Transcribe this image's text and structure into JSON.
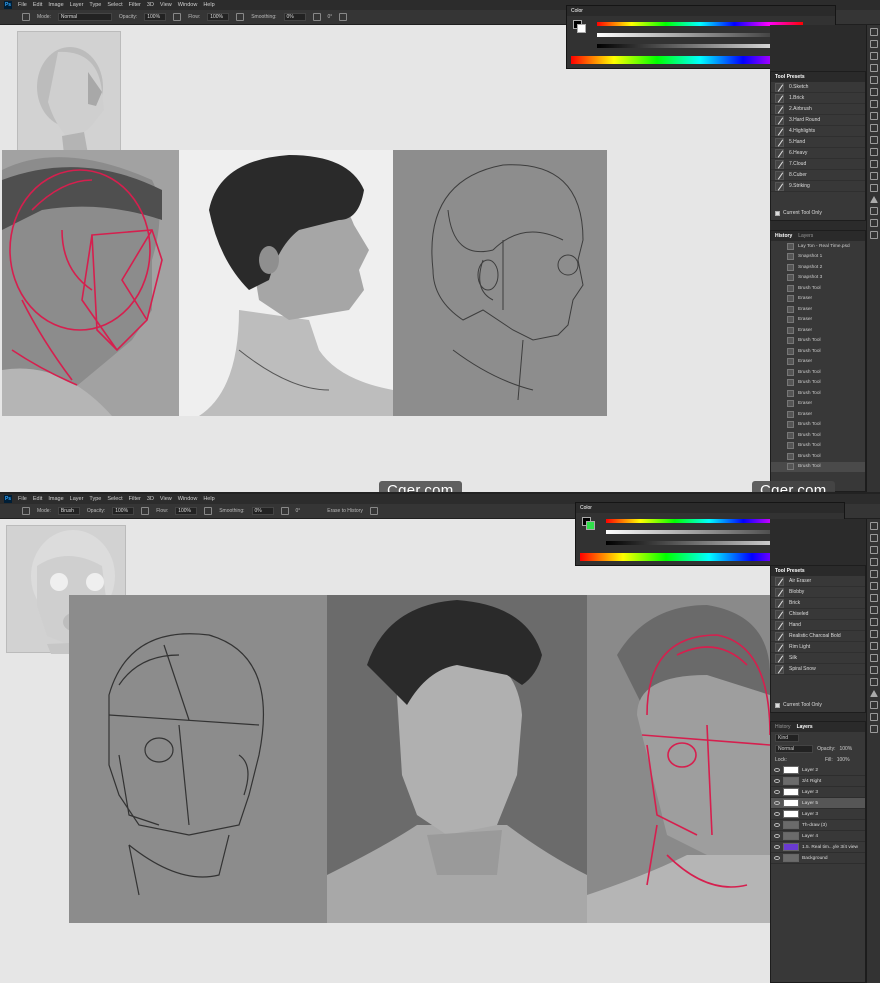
{
  "app": {
    "menu": [
      "File",
      "Edit",
      "Image",
      "Layer",
      "Type",
      "Select",
      "Filter",
      "3D",
      "View",
      "Window",
      "Help"
    ]
  },
  "top": {
    "options": {
      "mode_label": "Mode:",
      "mode_value": "Normal",
      "opacity_label": "Opacity:",
      "opacity_value": "100%",
      "flow_label": "Flow:",
      "flow_value": "100%",
      "smoothing_label": "Smoothing:",
      "smoothing_value": "0%",
      "angle_value": "0°"
    },
    "color_panel": {
      "title": "Color"
    },
    "tool_presets": {
      "title": "Tool Presets",
      "items": [
        "0.Sketch",
        "1.Brick",
        "2.Airbrush",
        "3.Hard Round",
        "4.Highlights",
        "5.Hand",
        "6.Heavy",
        "7.Cloud",
        "8.Cuber",
        "9.Striking"
      ],
      "current_only": "Current Tool Only"
    },
    "history": {
      "tab_active": "History",
      "tab_other": "Layers",
      "doc": "Lay Ton - Real Time.psd",
      "snapshots": [
        "Snapshot 1",
        "Snapshot 2",
        "Snapshot 3"
      ],
      "steps": [
        "Brush Tool",
        "Eraser",
        "Eraser",
        "Eraser",
        "Eraser",
        "Brush Tool",
        "Brush Tool",
        "Eraser",
        "Brush Tool",
        "Brush Tool",
        "Brush Tool",
        "Eraser",
        "Eraser",
        "Brush Tool",
        "Brush Tool",
        "Brush Tool",
        "Brush Tool",
        "Brush Tool"
      ]
    },
    "watermark": "Cger.com",
    "watermark_right": "Cger.com"
  },
  "bottom": {
    "options": {
      "mode_label": "Mode:",
      "mode_value": "Brush",
      "opacity_label": "Opacity:",
      "opacity_value": "100%",
      "flow_label": "Flow:",
      "flow_value": "100%",
      "smoothing_label": "Smoothing:",
      "smoothing_value": "0%",
      "angle_value": "0°",
      "erase_label": "Erase to History"
    },
    "color_panel": {
      "title": "Color"
    },
    "tool_presets": {
      "title": "Tool Presets",
      "items": [
        "Air Eraser",
        "Blobby",
        "Brick",
        "Chiseled",
        "Hand",
        "Realistic Charcoal Bold",
        "Rim Light",
        "Silk",
        "Spiral Snow"
      ],
      "current_only": "Current Tool Only"
    },
    "layers": {
      "tab_history": "History",
      "tab_active": "Layers",
      "kind": "Kind",
      "blend": "Normal",
      "opacity_label": "Opacity:",
      "opacity_value": "100%",
      "lock_label": "Lock:",
      "fill_label": "Fill:",
      "fill_value": "100%",
      "items": [
        "Layer 2",
        "3/4 Right",
        "Layer 3",
        "Layer 5",
        "Layer 3",
        "Th-draw (3)",
        "Layer 4",
        "1.5. Real tim...yle 3/4 view",
        "Background"
      ]
    }
  }
}
